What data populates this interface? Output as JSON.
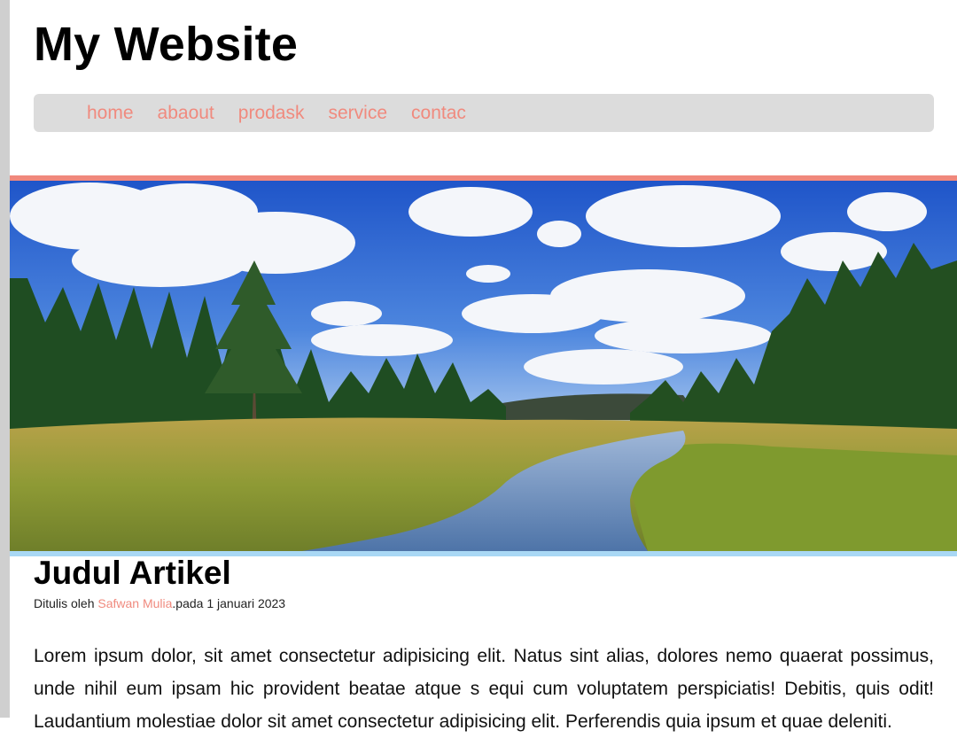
{
  "header": {
    "title": "My Website"
  },
  "nav": {
    "items": [
      {
        "label": "home"
      },
      {
        "label": "abaout"
      },
      {
        "label": "prodask"
      },
      {
        "label": "service"
      },
      {
        "label": "contac"
      }
    ]
  },
  "hero": {
    "image": "landscape-photo",
    "description": "Meadow with river, pine forest and cumulus clouds"
  },
  "article": {
    "title": "Judul Artikel",
    "meta": {
      "prefix": "Ditulis oleh ",
      "author": "Safwan Mulia",
      "suffix": ".pada 1 januari 2023"
    },
    "body": "Lorem ipsum dolor, sit amet consectetur adipisicing elit. Natus sint alias, dolores nemo quaerat possimus, unde nihil eum ipsam hic provident beatae atque s equi cum voluptatem perspiciatis! Debitis, quis odit! Laudantium molestiae dolor sit amet consectetur adipisicing elit. Perferendis quia ipsum et quae deleniti."
  },
  "colors": {
    "accent": "#f08a7e",
    "nav_bg": "#dcdcdc",
    "hero_top_border": "#f0887c",
    "hero_bottom_border": "#a9d8f5"
  }
}
